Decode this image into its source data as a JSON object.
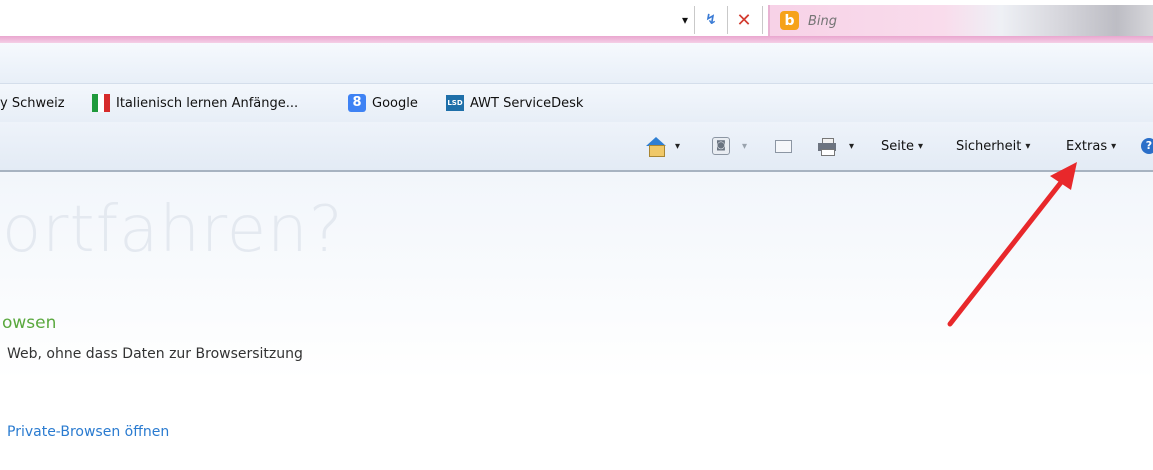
{
  "toolbar": {
    "address_dropdown": "▾",
    "refresh_icon": "↯",
    "stop_icon": "✕"
  },
  "search": {
    "placeholder": "Bing",
    "provider_logo": "b"
  },
  "favorites": [
    {
      "label": "y Schweiz"
    },
    {
      "label": "Italienisch lernen Anfänge..."
    },
    {
      "label": "Google",
      "icon_text": "8"
    },
    {
      "label": "AWT ServiceDesk",
      "icon_text": "LSD"
    }
  ],
  "command_bar": {
    "rss_glyph": "◙",
    "seite": "Seite",
    "sicherheit": "Sicherheit",
    "extras": "Extras",
    "dropdown": "▾",
    "help_glyph": "?"
  },
  "content": {
    "headline": "ortfahren?",
    "section_title": "owsen",
    "section_description": "Web, ohne dass Daten zur Browsersitzung",
    "open_link": "Private-Browsen öffnen"
  },
  "colors": {
    "annotation_arrow": "#e8282b",
    "section_title": "#5aa83e",
    "link": "#2a7bd0"
  }
}
